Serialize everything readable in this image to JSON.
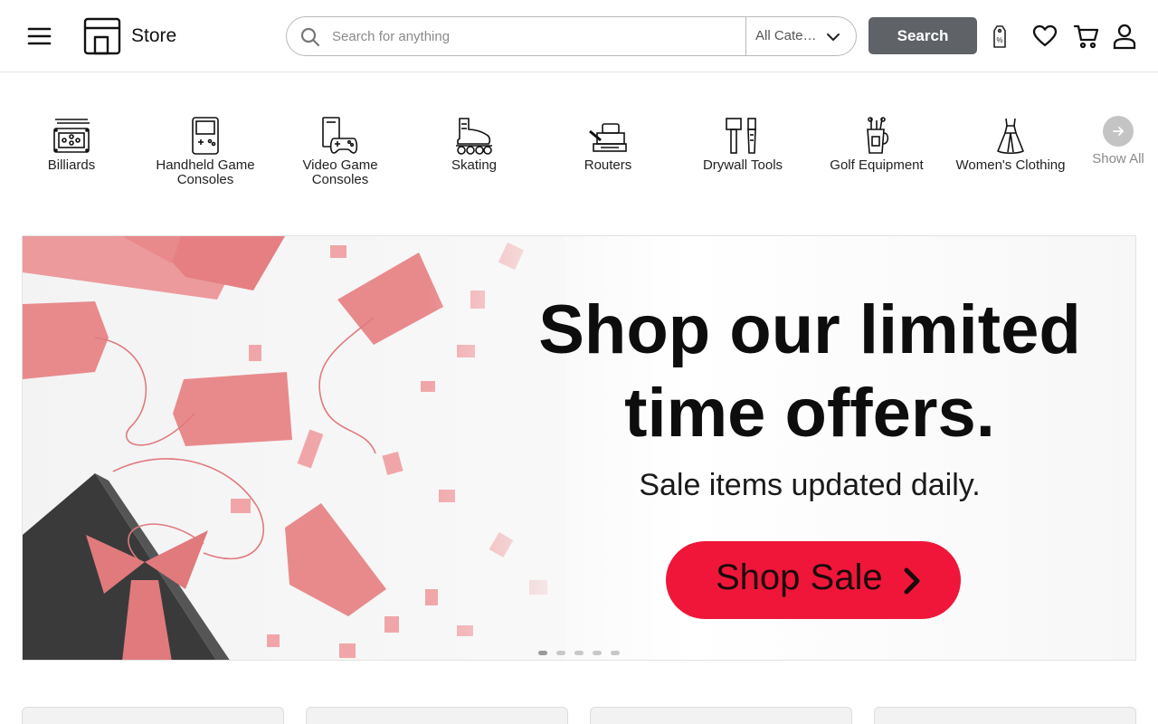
{
  "header": {
    "store_name": "Store",
    "search": {
      "placeholder": "Search for anything",
      "value": ""
    },
    "category_select": {
      "selected": "All Categories"
    },
    "search_button_label": "Search",
    "icons": [
      "menu-icon",
      "store-icon",
      "search-icon",
      "chevron-down-icon",
      "price-tag-icon",
      "heart-icon",
      "cart-icon",
      "user-icon"
    ]
  },
  "categories": {
    "items": [
      {
        "label": "Billiards",
        "icon": "billiards-icon"
      },
      {
        "label": "Handheld Game Consoles",
        "icon": "handheld-console-icon"
      },
      {
        "label": "Video Game Consoles",
        "icon": "video-game-console-icon"
      },
      {
        "label": "Skating",
        "icon": "roller-skate-icon"
      },
      {
        "label": "Routers",
        "icon": "router-icon"
      },
      {
        "label": "Drywall Tools",
        "icon": "drywall-tools-icon"
      },
      {
        "label": "Golf Equipment",
        "icon": "golf-bag-icon"
      },
      {
        "label": "Women's Clothing",
        "icon": "dress-icon"
      }
    ],
    "show_all_label": "Show All"
  },
  "hero": {
    "title": "Shop our limited time offers.",
    "subtitle": "Sale items updated daily.",
    "cta_label": "Shop Sale",
    "slide_count": 5,
    "active_slide": 1,
    "accent_color": "#f0163a"
  },
  "colors": {
    "search_button": "#5f6368",
    "border": "#b9b9b9",
    "hero_cta": "#f0163a",
    "tag_pink": "#e8888a"
  }
}
